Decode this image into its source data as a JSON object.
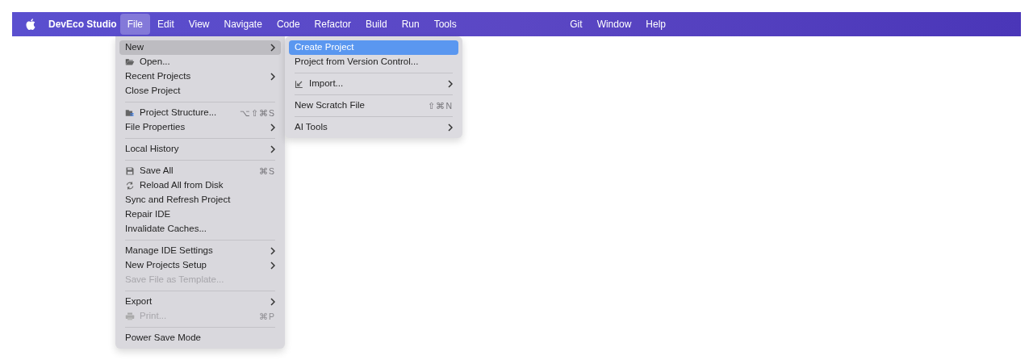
{
  "menubar": {
    "app_name": "DevEco Studio",
    "items": [
      {
        "label": "File",
        "selected": true
      },
      {
        "label": "Edit",
        "selected": false
      },
      {
        "label": "View",
        "selected": false
      },
      {
        "label": "Navigate",
        "selected": false
      },
      {
        "label": "Code",
        "selected": false
      },
      {
        "label": "Refactor",
        "selected": false
      },
      {
        "label": "Build",
        "selected": false
      },
      {
        "label": "Run",
        "selected": false
      },
      {
        "label": "Tools",
        "selected": false
      }
    ],
    "right_items": [
      {
        "label": "Git",
        "selected": false
      },
      {
        "label": "Window",
        "selected": false
      },
      {
        "label": "Help",
        "selected": false
      }
    ]
  },
  "file_menu": [
    {
      "kind": "item",
      "label": "New",
      "submenu": true,
      "selected": true,
      "disabled": false
    },
    {
      "kind": "item",
      "label": "Open...",
      "submenu": false,
      "selected": false,
      "disabled": false
    },
    {
      "kind": "item",
      "label": "Recent Projects",
      "submenu": true,
      "selected": false,
      "disabled": false
    },
    {
      "kind": "item",
      "label": "Close Project",
      "submenu": false,
      "selected": false,
      "disabled": false
    },
    {
      "kind": "separator"
    },
    {
      "kind": "item",
      "label": "Project Structure...",
      "shortcut": "⌥⇧⌘S",
      "submenu": false,
      "selected": false,
      "disabled": false
    },
    {
      "kind": "item",
      "label": "File Properties",
      "submenu": true,
      "selected": false,
      "disabled": false
    },
    {
      "kind": "separator"
    },
    {
      "kind": "item",
      "label": "Local History",
      "submenu": true,
      "selected": false,
      "disabled": false
    },
    {
      "kind": "separator"
    },
    {
      "kind": "item",
      "label": "Save All",
      "shortcut": "⌘S",
      "submenu": false,
      "selected": false,
      "disabled": false
    },
    {
      "kind": "item",
      "label": "Reload All from Disk",
      "submenu": false,
      "selected": false,
      "disabled": false
    },
    {
      "kind": "item",
      "label": "Sync and Refresh Project",
      "submenu": false,
      "selected": false,
      "disabled": false
    },
    {
      "kind": "item",
      "label": "Repair IDE",
      "submenu": false,
      "selected": false,
      "disabled": false
    },
    {
      "kind": "item",
      "label": "Invalidate Caches...",
      "submenu": false,
      "selected": false,
      "disabled": false
    },
    {
      "kind": "separator"
    },
    {
      "kind": "item",
      "label": "Manage IDE Settings",
      "submenu": true,
      "selected": false,
      "disabled": false
    },
    {
      "kind": "item",
      "label": "New Projects Setup",
      "submenu": true,
      "selected": false,
      "disabled": false
    },
    {
      "kind": "item",
      "label": "Save File as Template...",
      "submenu": false,
      "selected": false,
      "disabled": true
    },
    {
      "kind": "separator"
    },
    {
      "kind": "item",
      "label": "Export",
      "submenu": true,
      "selected": false,
      "disabled": false
    },
    {
      "kind": "item",
      "label": "Print...",
      "shortcut": "⌘P",
      "submenu": false,
      "selected": false,
      "disabled": true
    },
    {
      "kind": "separator"
    },
    {
      "kind": "item",
      "label": "Power Save Mode",
      "submenu": false,
      "selected": false,
      "disabled": false
    }
  ],
  "new_submenu": [
    {
      "kind": "item",
      "label": "Create Project",
      "submenu": false,
      "selected": true,
      "disabled": false
    },
    {
      "kind": "item",
      "label": "Project from Version Control...",
      "submenu": false,
      "selected": false,
      "disabled": false
    },
    {
      "kind": "separator"
    },
    {
      "kind": "item",
      "label": "Import...",
      "submenu": true,
      "selected": false,
      "disabled": false
    },
    {
      "kind": "separator"
    },
    {
      "kind": "item",
      "label": "New Scratch File",
      "shortcut": "⇧⌘N",
      "submenu": false,
      "selected": false,
      "disabled": false
    },
    {
      "kind": "separator"
    },
    {
      "kind": "item",
      "label": "AI Tools",
      "submenu": true,
      "selected": false,
      "disabled": false
    }
  ]
}
